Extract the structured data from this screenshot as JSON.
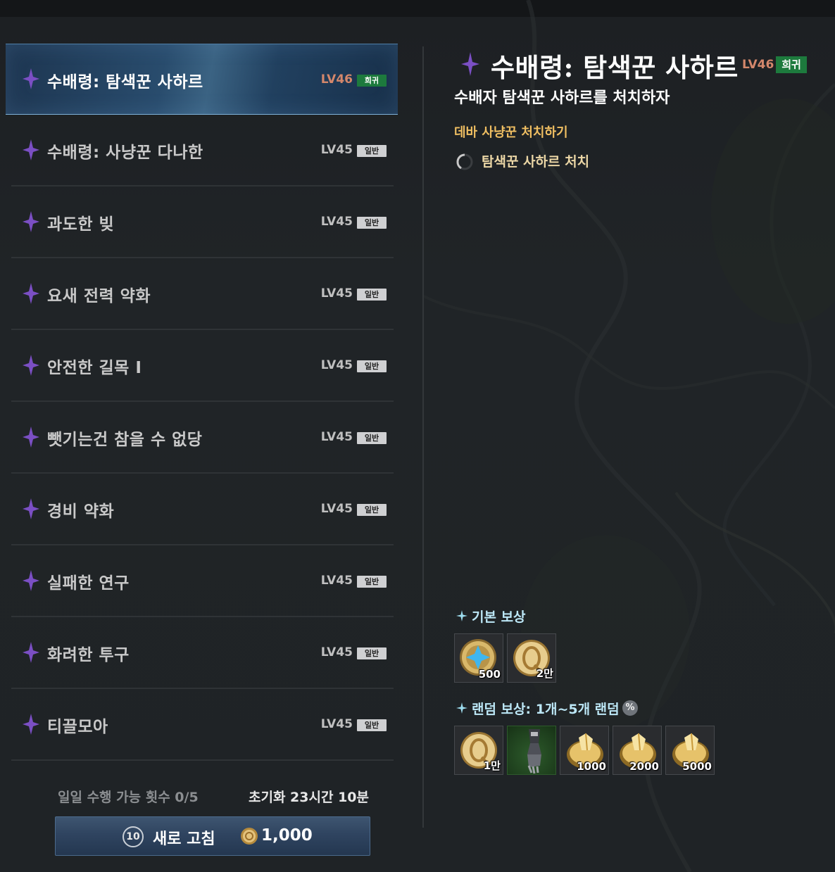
{
  "quests": [
    {
      "name": "수배령: 탐색꾼 사하르",
      "level": "LV46",
      "grade": "희귀",
      "selected": true
    },
    {
      "name": "수배령: 사냥꾼 다나한",
      "level": "LV45",
      "grade": "일반"
    },
    {
      "name": "과도한 빚",
      "level": "LV45",
      "grade": "일반"
    },
    {
      "name": "요새 전력 약화",
      "level": "LV45",
      "grade": "일반"
    },
    {
      "name": "안전한 길목 I",
      "level": "LV45",
      "grade": "일반"
    },
    {
      "name": "뺏기는건 참을 수 없당",
      "level": "LV45",
      "grade": "일반"
    },
    {
      "name": "경비 약화",
      "level": "LV45",
      "grade": "일반"
    },
    {
      "name": "실패한 연구",
      "level": "LV45",
      "grade": "일반"
    },
    {
      "name": "화려한 투구",
      "level": "LV45",
      "grade": "일반"
    },
    {
      "name": "티끌모아",
      "level": "LV45",
      "grade": "일반"
    }
  ],
  "footer": {
    "daily_count": "일일 수행 가능 횟수 0/5",
    "reset_time": "초기화 23시간 10분",
    "refresh_count": "10",
    "refresh_label": "새로 고침",
    "refresh_cost": "1,000"
  },
  "detail": {
    "title": "수배령: 탐색꾼 사하르",
    "level": "LV46",
    "grade": "희귀",
    "subtitle": "수배자 탐색꾼 사하르를 처치하자",
    "objective_title": "데바 사냥꾼 처치하기",
    "task": "탐색꾼 사하르 처치"
  },
  "rewards": {
    "basic_title": "기본 보상",
    "basic_items": [
      {
        "icon": "blue-star-coin-icon",
        "qty": "500"
      },
      {
        "icon": "gold-coin-icon",
        "qty": "2만"
      }
    ],
    "random_title": "랜덤 보상: 1개~5개 랜덤",
    "random_icon": "%",
    "random_items": [
      {
        "icon": "gold-coin-icon",
        "qty": "1만"
      },
      {
        "icon": "gauntlet-icon",
        "qty": ""
      },
      {
        "icon": "gold-crystal-icon",
        "qty": "1000"
      },
      {
        "icon": "gold-crystal-icon",
        "qty": "2000"
      },
      {
        "icon": "gold-crystal-icon",
        "qty": "5000"
      }
    ]
  },
  "colors": {
    "rare_grade": "#1d7a3d",
    "level_rare": "#d4876b",
    "objective": "#f0bf62",
    "reward_title": "#bce7f6",
    "quest_star": "#7b4fc4"
  }
}
